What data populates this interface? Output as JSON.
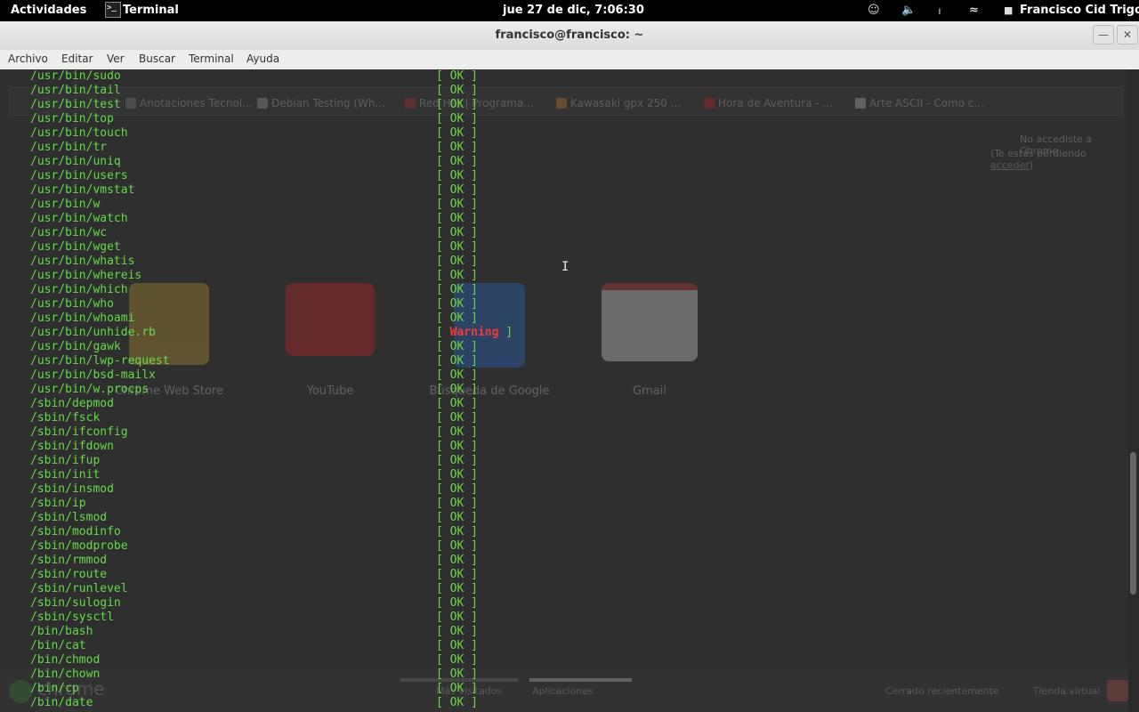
{
  "topbar": {
    "activities": "Actividades",
    "app_name": "Terminal",
    "clock": "jue 27 de dic,  7:06:30",
    "user": "Francisco Cid Trigo"
  },
  "window": {
    "title": "francisco@francisco: ~"
  },
  "menu": [
    "Archivo",
    "Editar",
    "Ver",
    "Buscar",
    "Terminal",
    "Ayuda"
  ],
  "background_chrome": {
    "bookmarks": [
      "Anotaciones Tecnol...",
      "Debian Testing (Wh...",
      "Red Hat | Programa...",
      "Kawasaki gpx 250 ...",
      "Hora de Aventura - ...",
      "Arte ASCII - Como c..."
    ],
    "signin_line1": "No accediste a Chrome",
    "signin_line2_prefix": "(Te estás perdiendo ",
    "signin_link": "acceder",
    "signin_line2_suffix": ")",
    "apps": [
      "Chrome Web Store",
      "YouTube",
      "Búsqueda de Google",
      "Gmail"
    ],
    "bottom": {
      "logo_text": "chrome",
      "tab1": "Más visitados",
      "tab2": "Aplicaciones",
      "recent": "Cerrado recientemente",
      "store": "Tienda virtual"
    }
  },
  "terminal": {
    "lines": [
      {
        "path": "/usr/bin/sudo",
        "status": "OK"
      },
      {
        "path": "/usr/bin/tail",
        "status": "OK"
      },
      {
        "path": "/usr/bin/test",
        "status": "OK"
      },
      {
        "path": "/usr/bin/top",
        "status": "OK"
      },
      {
        "path": "/usr/bin/touch",
        "status": "OK"
      },
      {
        "path": "/usr/bin/tr",
        "status": "OK"
      },
      {
        "path": "/usr/bin/uniq",
        "status": "OK"
      },
      {
        "path": "/usr/bin/users",
        "status": "OK"
      },
      {
        "path": "/usr/bin/vmstat",
        "status": "OK"
      },
      {
        "path": "/usr/bin/w",
        "status": "OK"
      },
      {
        "path": "/usr/bin/watch",
        "status": "OK"
      },
      {
        "path": "/usr/bin/wc",
        "status": "OK"
      },
      {
        "path": "/usr/bin/wget",
        "status": "OK"
      },
      {
        "path": "/usr/bin/whatis",
        "status": "OK"
      },
      {
        "path": "/usr/bin/whereis",
        "status": "OK"
      },
      {
        "path": "/usr/bin/which",
        "status": "OK"
      },
      {
        "path": "/usr/bin/who",
        "status": "OK"
      },
      {
        "path": "/usr/bin/whoami",
        "status": "OK"
      },
      {
        "path": "/usr/bin/unhide.rb",
        "status": "Warning"
      },
      {
        "path": "/usr/bin/gawk",
        "status": "OK"
      },
      {
        "path": "/usr/bin/lwp-request",
        "status": "OK"
      },
      {
        "path": "/usr/bin/bsd-mailx",
        "status": "OK"
      },
      {
        "path": "/usr/bin/w.procps",
        "status": "OK"
      },
      {
        "path": "/sbin/depmod",
        "status": "OK"
      },
      {
        "path": "/sbin/fsck",
        "status": "OK"
      },
      {
        "path": "/sbin/ifconfig",
        "status": "OK"
      },
      {
        "path": "/sbin/ifdown",
        "status": "OK"
      },
      {
        "path": "/sbin/ifup",
        "status": "OK"
      },
      {
        "path": "/sbin/init",
        "status": "OK"
      },
      {
        "path": "/sbin/insmod",
        "status": "OK"
      },
      {
        "path": "/sbin/ip",
        "status": "OK"
      },
      {
        "path": "/sbin/lsmod",
        "status": "OK"
      },
      {
        "path": "/sbin/modinfo",
        "status": "OK"
      },
      {
        "path": "/sbin/modprobe",
        "status": "OK"
      },
      {
        "path": "/sbin/rmmod",
        "status": "OK"
      },
      {
        "path": "/sbin/route",
        "status": "OK"
      },
      {
        "path": "/sbin/runlevel",
        "status": "OK"
      },
      {
        "path": "/sbin/sulogin",
        "status": "OK"
      },
      {
        "path": "/sbin/sysctl",
        "status": "OK"
      },
      {
        "path": "/bin/bash",
        "status": "OK"
      },
      {
        "path": "/bin/cat",
        "status": "OK"
      },
      {
        "path": "/bin/chmod",
        "status": "OK"
      },
      {
        "path": "/bin/chown",
        "status": "OK"
      },
      {
        "path": "/bin/cp",
        "status": "OK"
      },
      {
        "path": "/bin/date",
        "status": "OK"
      }
    ],
    "text_color": "#66d94a",
    "warning_color": "#ef3c3c"
  }
}
